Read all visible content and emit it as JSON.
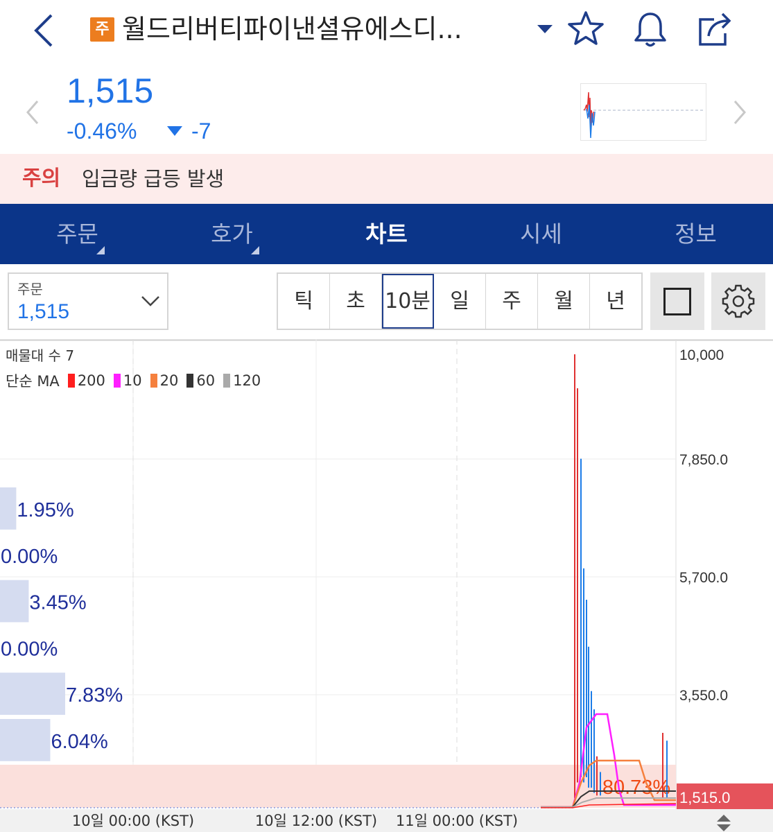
{
  "header": {
    "badge": "주",
    "title": "월드리버티파이낸셜유에스디...",
    "icons": [
      "back-icon",
      "dropdown-icon",
      "star-icon",
      "bell-icon",
      "share-icon"
    ]
  },
  "quote": {
    "price": "1,515",
    "change_pct": "-0.46%",
    "change_abs": "-7",
    "color": "#2173e6"
  },
  "alert": {
    "label": "주의",
    "text": "입금량 급등 발생"
  },
  "tabs": [
    {
      "label": "주문"
    },
    {
      "label": "호가"
    },
    {
      "label": "차트"
    },
    {
      "label": "시세"
    },
    {
      "label": "정보"
    }
  ],
  "toolbar": {
    "order_label": "주문",
    "order_value": "1,515",
    "periods": [
      "틱",
      "초",
      "10분",
      "일",
      "주",
      "월",
      "년"
    ],
    "selected_period": "10분"
  },
  "chart_data": {
    "type": "candlestick",
    "volume_profile_label": "매물대 수 7",
    "ma_legend_label": "단순 MA",
    "ma_series": [
      {
        "name": "200",
        "color": "#ff1f1f"
      },
      {
        "name": "10",
        "color": "#ff1fff"
      },
      {
        "name": "20",
        "color": "#f5803e"
      },
      {
        "name": "60",
        "color": "#333333"
      },
      {
        "name": "120",
        "color": "#aaaaaa"
      }
    ],
    "y_ticks": [
      "10,000",
      "7,850.0",
      "5,700.0",
      "3,550.0"
    ],
    "ylim": [
      1515,
      10000
    ],
    "x_ticks": [
      "10일 00:00 (KST)",
      "10일 12:00 (KST)",
      "11일 00:00 (KST)"
    ],
    "current_price_label": "1,515.0",
    "volume_profile": [
      {
        "pct": "1.95%",
        "value": 1.95
      },
      {
        "pct": "0.00%",
        "value": 0
      },
      {
        "pct": "3.45%",
        "value": 3.45
      },
      {
        "pct": "0.00%",
        "value": 0
      },
      {
        "pct": "7.83%",
        "value": 7.83
      },
      {
        "pct": "6.04%",
        "value": 6.04
      },
      {
        "pct": "80.73%",
        "value": 80.73
      }
    ],
    "colors": {
      "up": "#e03131",
      "down": "#1c7ce8",
      "profile": "#d5dcf0",
      "profile_dominant": "#fbe0dc",
      "price_tag": "#e5535b"
    }
  }
}
